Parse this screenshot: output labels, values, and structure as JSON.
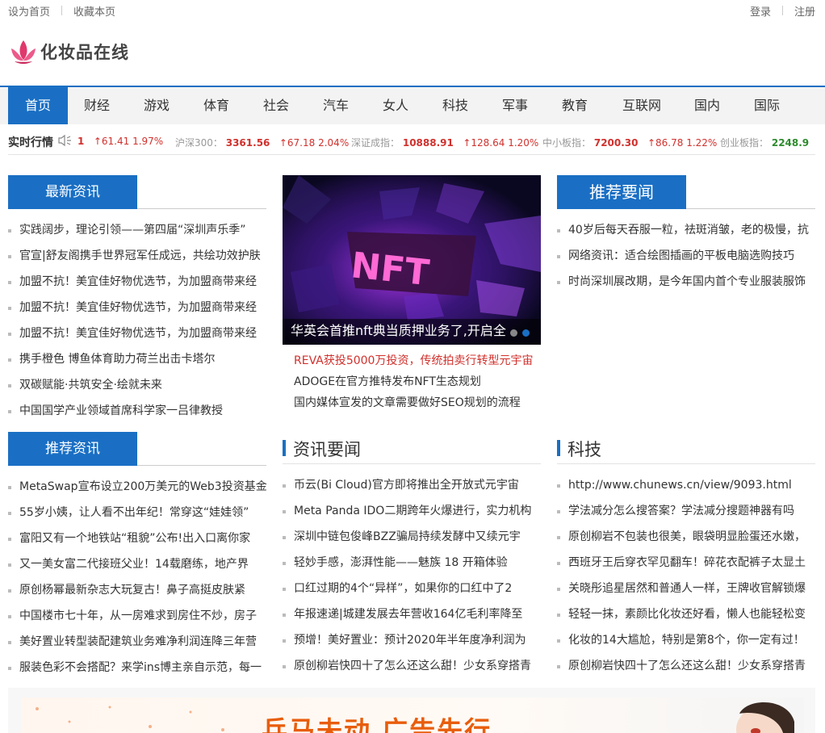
{
  "topbar": {
    "set_home": "设为首页",
    "bookmark": "收藏本页",
    "login": "登录",
    "register": "注册"
  },
  "logo": {
    "text": "化妆品在线",
    "icon": "lotus-icon"
  },
  "nav": {
    "items": [
      "首页",
      "财经",
      "游戏",
      "体育",
      "社会",
      "汽车",
      "女人",
      "科技",
      "军事",
      "教育",
      "互联网",
      "国内",
      "国际"
    ],
    "active_index": 0
  },
  "ticker": {
    "label": "实时行情",
    "icon": "speaker-icon",
    "partial": {
      "value": "1",
      "change": "↑61.41",
      "pct": "1.97%"
    },
    "indices": [
      {
        "name": "沪深300：",
        "value": "3361.56",
        "change": "↑67.18",
        "pct": "2.04%"
      },
      {
        "name": "深证成指：",
        "value": "10888.91",
        "change": "↑128.64",
        "pct": "1.20%"
      },
      {
        "name": "中小板指：",
        "value": "7200.30",
        "change": "↑86.78",
        "pct": "1.22%"
      },
      {
        "name": "创业板指：",
        "value": "2248.9"
      }
    ]
  },
  "latest": {
    "title": "最新资讯",
    "items": [
      "实践阔步，理论引领——第四届“深圳声乐季”",
      "官宣|舒友阁携手世界冠军任成远，共绘功效护肤",
      "加盟不抗！美宜佳好物优选节，为加盟商带来经",
      "加盟不抗！美宜佳好物优选节，为加盟商带来经",
      "加盟不抗！美宜佳好物优选节，为加盟商带来经",
      "携手橙色 博鱼体育助力荷兰出击卡塔尔",
      "双碳赋能·共筑安全·绘就未来",
      "中国国学产业领域首席科学家一吕律教授"
    ]
  },
  "featured": {
    "image_text": "NFT",
    "caption": "华英会首推nft典当质押业务了,开启全",
    "links": [
      "REVA获投5000万投资，传统拍卖行转型元宇宙",
      "ADOGE在官方推特发布NFT生态规划",
      "国内媒体宣发的文章需要做好SEO规划的流程"
    ]
  },
  "top_news": {
    "title": "推荐要闻",
    "items": [
      "40岁后每天吞服一粒，祛斑消皱，老的极慢，抗",
      "网络资讯：适合绘图插画的平板电脑选购技巧",
      "时尚深圳展改期，是今年国内首个专业服装服饰"
    ]
  },
  "recommended": {
    "title": "推荐资讯",
    "items": [
      "MetaSwap宣布设立200万美元的Web3投资基金",
      "55岁小姨，让人看不出年纪！常穿这“娃娃领”",
      "富阳又有一个地铁站“租貌”公布!出入口离你家",
      "又一美女富二代接班父业！14载磨练，地产界",
      "原创杨幂最新杂志大玩复古！鼻子高挺皮肤紧",
      "中国楼市七十年，从一房难求到房住不炒，房子",
      "美好置业转型装配建筑业务难净利润连降三年营",
      "服装色彩不会搭配？来学ins博主亲自示范，每一"
    ]
  },
  "news": {
    "title": "资讯要闻",
    "items": [
      "币云(Bi Cloud)官方即将推出全开放式元宇宙",
      "Meta Panda IDO二期跨年火爆进行，实力机构",
      "深圳中链包俊峰BZZ骗局持续发酵中又续元宇",
      "轻妙手感，澎湃性能——魅族 18 开箱体验",
      "口红过期的4个“异样”，如果你的口红中了2",
      "年报速递|城建发展去年营收164亿毛利率降至",
      "预增！美好置业：预计2020年半年度净利润为",
      "原创柳岩快四十了怎么还这么甜！少女系穿搭青"
    ]
  },
  "tech": {
    "title": "科技",
    "items": [
      "http://www.chunews.cn/view/9093.html",
      "学法减分怎么搜答案？学法减分搜题神器有吗",
      "原创柳岩不包装也很美，眼袋明显脸蛋还水嫩，",
      "西班牙王后穿衣罕见翻车！碎花衣配裤子太显土",
      "关晓彤追星居然和普通人一样，王牌收官解锁爆",
      "轻轻一抹，素颜比化妆还好看，懒人也能轻松变",
      "化妆的14大尴尬，特别是第8个，你一定有过！",
      "原创柳岩快四十了怎么还这么甜！少女系穿搭青"
    ]
  },
  "ad": {
    "slogan": "兵马未动 广告先行"
  },
  "colors": {
    "brand": "#1a6fc4",
    "up": "#d0312d",
    "accent": "#e85d0c"
  }
}
